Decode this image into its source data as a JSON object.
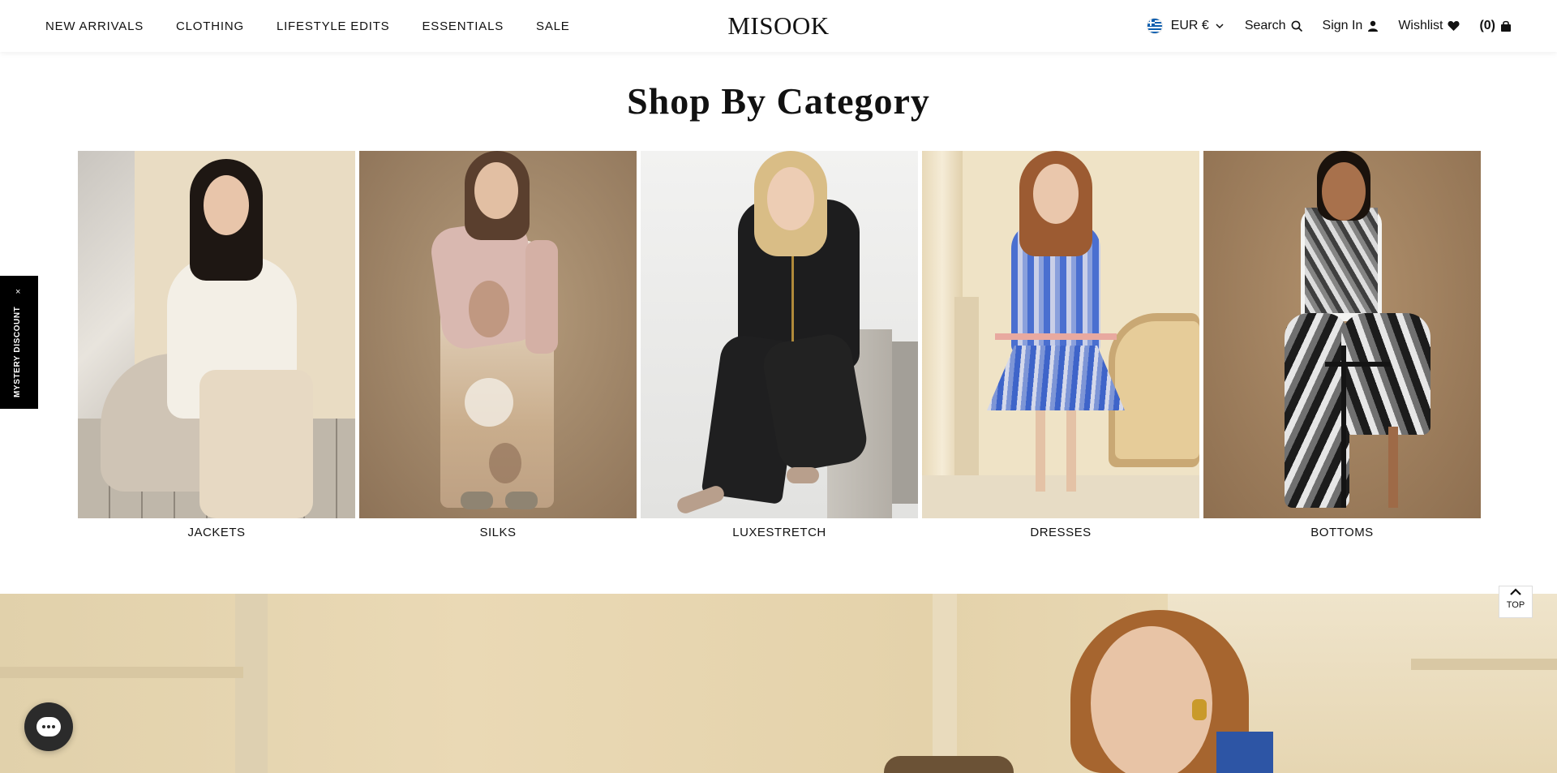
{
  "header": {
    "nav": [
      "NEW ARRIVALS",
      "CLOTHING",
      "LIFESTYLE EDITS",
      "ESSENTIALS",
      "SALE"
    ],
    "logo": "MISOOK",
    "currency": "EUR €",
    "search": "Search",
    "sign_in": "Sign In",
    "wishlist": "Wishlist",
    "cart": "(0)"
  },
  "section": {
    "title": "Shop By Category"
  },
  "categories": [
    "JACKETS",
    "SILKS",
    "LUXESTRETCH",
    "DRESSES",
    "BOTTOMS"
  ],
  "mystery": {
    "label": "MYSTERY DISCOUNT",
    "close": "×"
  },
  "top_button": {
    "label": "TOP"
  },
  "colors": {
    "jackets_bg": "#d9cdb8",
    "silks_bg": "#a08666",
    "luxestretch_bg": "#eaeaea",
    "dresses_bg": "#efe3c6",
    "bottoms_bg": "#9c7d5c",
    "hero_bg": "#e6d7b3"
  }
}
